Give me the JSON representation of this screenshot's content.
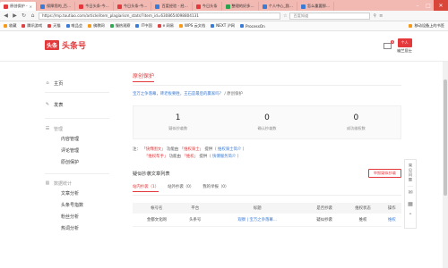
{
  "browser": {
    "tabs": [
      {
        "label": "原创保护 -",
        "active": true
      },
      {
        "label": "保障您的_百…",
        "active": false
      },
      {
        "label": "今日头条-今…",
        "active": false
      },
      {
        "label": "今日头条-今…",
        "active": false
      },
      {
        "label": "百度经验 - 经…",
        "active": false
      },
      {
        "label": "今日头条",
        "active": false
      },
      {
        "label": "整理的好多…",
        "active": false
      },
      {
        "label": "个人中心_我…",
        "active": false
      },
      {
        "label": "怎么重要那…",
        "active": false
      }
    ],
    "url": "https://mp.toutiao.com/article/item_plagiarism_stats/?item_id=6308654098804131",
    "search_placeholder": "百度知道",
    "bookmarks": [
      "收藏",
      "腾讯游戏",
      "天猫",
      "唯品会",
      "佛教网",
      "慢热观察",
      "IT中国",
      "e 网易",
      "WPS 云文档",
      "NEXT 沪网",
      "ProcessOn"
    ],
    "bookmarks_right": "移动设备上的书签"
  },
  "header": {
    "logo_mark": "头条",
    "logo_name": "头条号",
    "mail_badge": "4",
    "avatar_text": "个人",
    "username": "幽兰居士"
  },
  "sidebar": {
    "home": "主页",
    "publish": "发表",
    "manage_group": "管理",
    "manage_items": [
      "内容管理",
      "评论管理",
      "原创保护"
    ],
    "data_group": "数据统计",
    "data_items": [
      "文章分析",
      "头条号指数",
      "粉丝分析",
      "热词分析"
    ]
  },
  "main": {
    "title": "原创保护",
    "crumb_link": "宝万之争落幕，砖老板要胜，王石是最后的赢家吗？",
    "crumb_tail": "/ 原创保护",
    "stats": [
      {
        "num": "1",
        "label": "疑似抄袭数"
      },
      {
        "num": "0",
        "label": "确认抄袭数"
      },
      {
        "num": "0",
        "label": "成功维权数"
      }
    ],
    "notes": {
      "prefix": "注：",
      "l1_a": "「快傅图文」",
      "l1_b": "功能由",
      "l1_c": "「维权骑士」",
      "l1_d": "提供（",
      "l1_e": "维权骑士简介",
      "l1_f": "）",
      "l2_a": "「维权帮手」",
      "l2_b": "功能由",
      "l2_c": "「维权」",
      "l2_d": "提供（",
      "l2_e": "快傅服务简介",
      "l2_f": "）"
    },
    "list_title": "疑似抄袭文章列表",
    "report_button": "举报疑似抄袭",
    "tabs": [
      "站内抄袭（1）",
      "站外抄袭（0）",
      "我的举报（0）"
    ],
    "table": {
      "headers": [
        "帐号名",
        "平台",
        "标题",
        "是否抄袭",
        "维权状态",
        "操作"
      ],
      "rows": [
        [
          "金都文化网",
          "头条号",
          "观察 | 宝万之争落幕…",
          "疑似抄袭",
          "维权",
          "维权"
        ]
      ]
    }
  },
  "float_panel": {
    "feedback": "常见问题"
  }
}
